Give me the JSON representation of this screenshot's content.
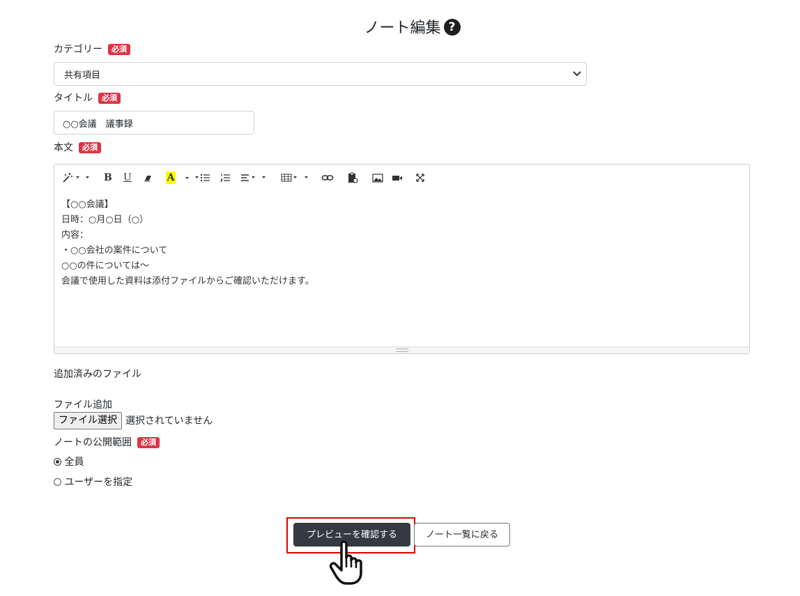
{
  "header": {
    "title": "ノート編集",
    "help_glyph": "?"
  },
  "required_badge": "必須",
  "form": {
    "category": {
      "label": "カテゴリー",
      "selected": "共有項目"
    },
    "title": {
      "label": "タイトル",
      "value": "○○会議　議事録"
    },
    "body": {
      "label": "本文",
      "lines": [
        "【○○会議】",
        "日時：○月○日（○）",
        "内容：",
        "・○○会社の案件について",
        "○○の件については～",
        "会議で使用した資料は添付ファイルからご確認いただけます。"
      ]
    },
    "attached_files_label": "追加済みのファイル",
    "file_add": {
      "label": "ファイル追加",
      "button": "ファイル選択",
      "status": "選択されていません"
    },
    "visibility": {
      "label": "ノートの公開範囲",
      "options": [
        {
          "label": "全員",
          "selected": true
        },
        {
          "label": "ユーザーを指定",
          "selected": false
        }
      ]
    }
  },
  "toolbar": {
    "icons": [
      "magic-icon",
      "bold-icon",
      "underline-icon",
      "eraser-icon",
      "font-color-icon",
      "unordered-list-icon",
      "ordered-list-icon",
      "align-icon",
      "table-icon",
      "link-icon",
      "paste-icon",
      "picture-icon",
      "video-icon",
      "fullscreen-icon"
    ],
    "bold_glyph": "B",
    "underline_glyph": "U",
    "color_glyph": "A",
    "highlight_color": "#ffff00"
  },
  "actions": {
    "preview": "プレビューを確認する",
    "back": "ノート一覧に戻る"
  },
  "colors": {
    "required": "#dc3545",
    "primary_dark": "#343a40",
    "highlight_frame": "#e00000"
  }
}
